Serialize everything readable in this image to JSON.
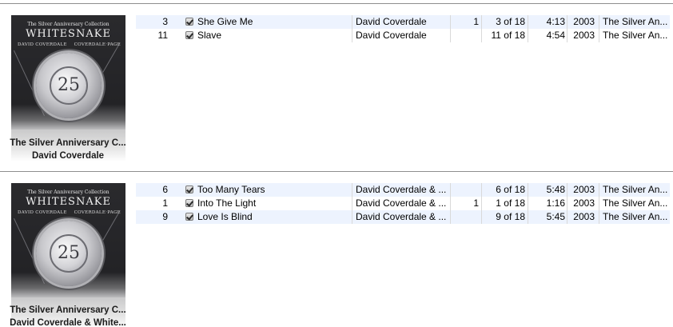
{
  "album_groups": [
    {
      "artwork": {
        "top_line": "The Silver Anniversary Collection",
        "band_name": "WHITESNAKE",
        "sub_left": "DAVID COVERDALE",
        "sub_right": "COVERDALE·PAGE",
        "seal_number": "25"
      },
      "caption_album": "The Silver Anniversary C...",
      "caption_artist": "David Coverdale",
      "rows": [
        {
          "number": "3",
          "name": "She Give Me",
          "artist": "David Coverdale",
          "disc": "1",
          "track": "3 of 18",
          "time": "4:13",
          "year": "2003",
          "album": "The Silver An..."
        },
        {
          "number": "11",
          "name": "Slave",
          "artist": "David Coverdale",
          "disc": "",
          "track": "11 of 18",
          "time": "4:54",
          "year": "2003",
          "album": "The Silver An..."
        }
      ]
    },
    {
      "artwork": {
        "top_line": "The Silver Anniversary Collection",
        "band_name": "WHITESNAKE",
        "sub_left": "DAVID COVERDALE",
        "sub_right": "COVERDALE·PAGE",
        "seal_number": "25"
      },
      "caption_album": "The Silver Anniversary C...",
      "caption_artist": "David Coverdale & White...",
      "rows": [
        {
          "number": "6",
          "name": "Too Many Tears",
          "artist": "David Coverdale & ...",
          "disc": "",
          "track": "6 of 18",
          "time": "5:48",
          "year": "2003",
          "album": "The Silver An..."
        },
        {
          "number": "1",
          "name": "Into The Light",
          "artist": "David Coverdale & ...",
          "disc": "1",
          "track": "1 of 18",
          "time": "1:16",
          "year": "2003",
          "album": "The Silver An..."
        },
        {
          "number": "9",
          "name": "Love Is Blind",
          "artist": "David Coverdale & ...",
          "disc": "",
          "track": "9 of 18",
          "time": "5:45",
          "year": "2003",
          "album": "The Silver An..."
        }
      ]
    }
  ],
  "colors": {
    "row_alt": "#edf3fe",
    "divider": "#8e8e8e",
    "artwork_bg": "#232326"
  }
}
